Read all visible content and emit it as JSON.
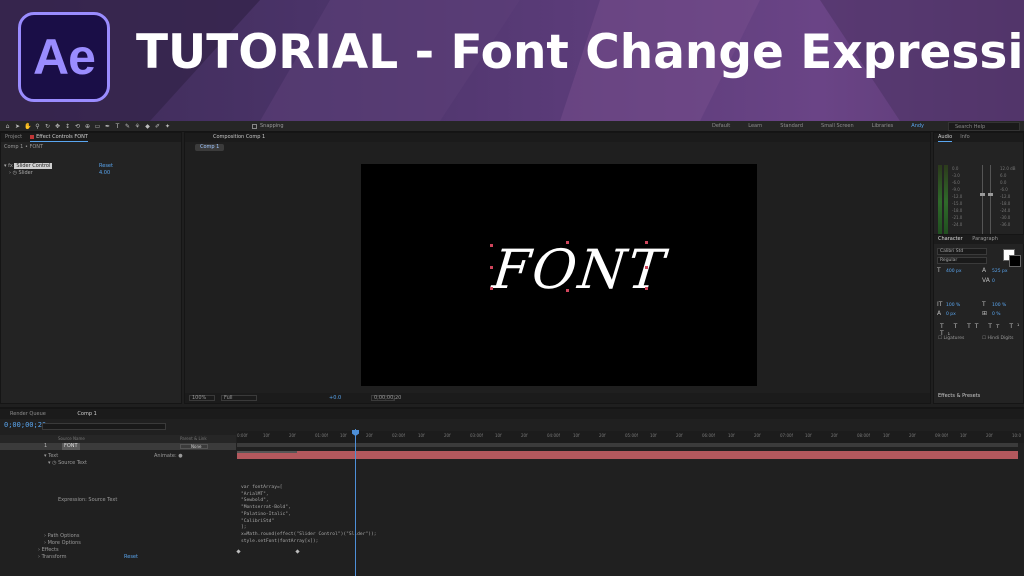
{
  "banner": {
    "logo_text": "Ae",
    "title": "TUTORIAL - Font Change Expression"
  },
  "toolbar": {
    "snapping_label": "Snapping",
    "workspaces": [
      "Default",
      "Learn",
      "Standard",
      "Small Screen",
      "Libraries",
      "Andy"
    ],
    "search_placeholder": "Search Help"
  },
  "effect_controls": {
    "tabs": [
      "Project",
      "Effect Controls FONT"
    ],
    "header": "Comp 1 • FONT",
    "effect_name": "Slider Control",
    "reset_label": "Reset",
    "slider_label": "Slider",
    "slider_value": "4.00"
  },
  "composition": {
    "tab_label": "Composition Comp 1",
    "sub_tab": "Comp 1",
    "canvas_text": "FONT",
    "zoom": "100%",
    "resolution": "Full",
    "exposure": "+0.0",
    "timecode": "0;00;00;20"
  },
  "right_panel": {
    "audio_tabs": [
      "Audio",
      "Info"
    ],
    "meter_labels": [
      "0.0",
      "-3.0",
      "-6.0",
      "-9.0",
      "-12.0",
      "-15.0",
      "-18.0",
      "-21.0",
      "-24.0"
    ],
    "meter_labels_right": [
      "12.0 dB",
      "6.0",
      "0.0",
      "-6.0",
      "-12.0",
      "-18.0",
      "-24.0",
      "-30.0",
      "-36.0"
    ],
    "character_tabs": [
      "Character",
      "Paragraph"
    ],
    "font_family": "Calibri Std",
    "font_style": "Regular",
    "font_size": "400 px",
    "leading": "525 px",
    "tracking": "0",
    "vert_scale": "100 %",
    "horiz_scale": "100 %",
    "baseline": "0 px",
    "tsume": "0 %",
    "ligatures_label": "Ligatures",
    "hindi_digits_label": "Hindi Digits",
    "effects_presets_title": "Effects & Presets"
  },
  "timeline": {
    "tabs": [
      "Render Queue",
      "Comp 1"
    ],
    "timecode": "0;00;00;20",
    "columns": [
      "Source Name",
      "Parent & Link"
    ],
    "layer": {
      "number": "1",
      "name": "FONT",
      "parent": "None"
    },
    "properties": {
      "text": "Text",
      "animate": "Animate:",
      "source_text": "Source Text",
      "expression_label": "Expression: Source Text",
      "path_options": "Path Options",
      "more_options": "More Options",
      "effects": "Effects",
      "transform": "Transform",
      "reset": "Reset"
    },
    "ruler_labels": [
      "0:00f",
      "10f",
      "20f",
      "01:00f",
      "10f",
      "20f",
      "02:00f",
      "10f",
      "20f",
      "03:00f",
      "10f",
      "20f",
      "04:00f",
      "10f",
      "20f",
      "05:00f",
      "10f",
      "20f",
      "06:00f",
      "10f",
      "20f",
      "07:00f",
      "10f",
      "20f",
      "08:00f",
      "10f",
      "20f",
      "09:00f",
      "10f",
      "20f",
      "10:0"
    ],
    "expression_code": "var fontArray=[\n\"ArialMT\",\n\"Sewbold\",\n\"Montserrat-Bold\",\n\"Palatino-Italic\",\n\"CalibriStd\"\n];\nx=Math.round(effect(\"Slider Control\")(\"Slider\"));\nstyle.setFont(fontArray[x]);"
  }
}
